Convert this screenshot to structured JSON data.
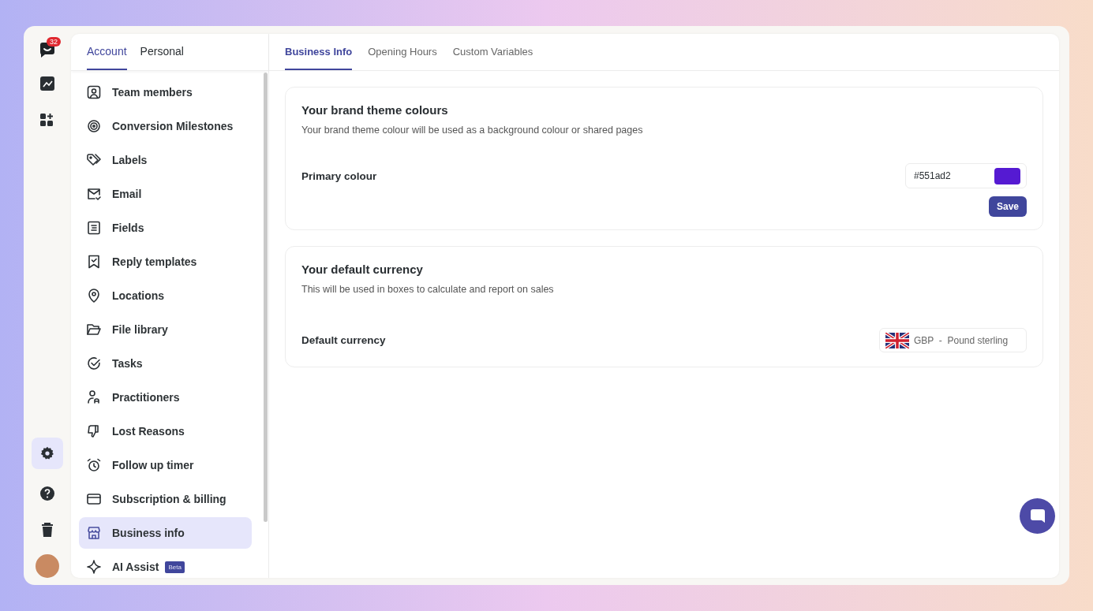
{
  "rail": {
    "badge": "32",
    "items": [
      {
        "kind": "chart",
        "selected": false
      },
      {
        "kind": "apps",
        "selected": false
      }
    ],
    "bottom": [
      {
        "kind": "settings",
        "selected": true
      },
      {
        "kind": "help",
        "selected": false
      },
      {
        "kind": "trash",
        "selected": false
      }
    ]
  },
  "sidebar": {
    "tabs": [
      {
        "label": "Account",
        "selected": true
      },
      {
        "label": "Personal",
        "selected": false
      }
    ],
    "items": [
      {
        "label": "Team members",
        "kind": "user-card",
        "selected": false
      },
      {
        "label": "Conversion Milestones",
        "kind": "target",
        "selected": false
      },
      {
        "label": "Labels",
        "kind": "tags",
        "selected": false
      },
      {
        "label": "Email",
        "kind": "mail",
        "selected": false
      },
      {
        "label": "Fields",
        "kind": "list",
        "selected": false
      },
      {
        "label": "Reply templates",
        "kind": "bookmark",
        "selected": false
      },
      {
        "label": "Locations",
        "kind": "pin",
        "selected": false
      },
      {
        "label": "File library",
        "kind": "folder",
        "selected": false
      },
      {
        "label": "Tasks",
        "kind": "check",
        "selected": false
      },
      {
        "label": "Practitioners",
        "kind": "person",
        "selected": false
      },
      {
        "label": "Lost Reasons",
        "kind": "thumb",
        "selected": false
      },
      {
        "label": "Follow up timer",
        "kind": "alarm",
        "selected": false
      },
      {
        "label": "Subscription & billing",
        "kind": "card",
        "selected": false
      },
      {
        "label": "Business info",
        "kind": "store",
        "selected": true
      },
      {
        "label": "AI Assist",
        "kind": "sparkle",
        "selected": false,
        "badge": "Beta"
      }
    ]
  },
  "tabs": [
    {
      "label": "Business Info",
      "selected": true
    },
    {
      "label": "Opening Hours",
      "selected": false
    },
    {
      "label": "Custom Variables",
      "selected": false
    }
  ],
  "brand": {
    "title": "Your brand theme colours",
    "description": "Your brand theme colour will be used as a background colour or shared pages",
    "label": "Primary colour",
    "value": "#551ad2",
    "color": "#551ad2",
    "button": "Save"
  },
  "currency": {
    "title": "Your default currency",
    "description": "This will be used in boxes to calculate and report on sales",
    "label": "Default currency",
    "value": "GBP  -  Pound sterling"
  }
}
